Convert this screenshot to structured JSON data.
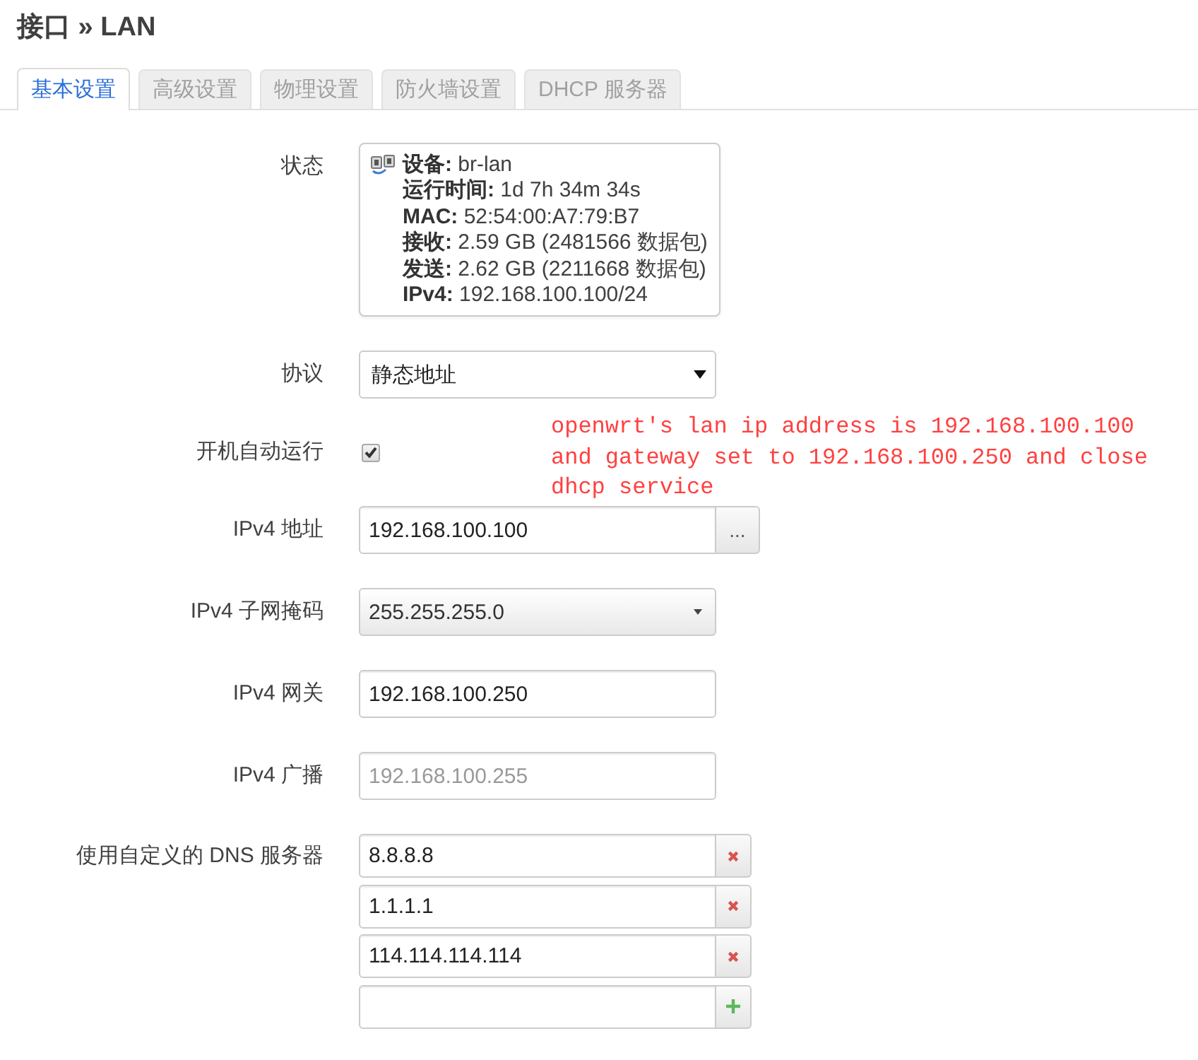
{
  "title": "接口 » LAN",
  "tabs": [
    {
      "label": "基本设置",
      "selected": true
    },
    {
      "label": "高级设置",
      "selected": false
    },
    {
      "label": "物理设置",
      "selected": false
    },
    {
      "label": "防火墙设置",
      "selected": false
    },
    {
      "label": "DHCP 服务器",
      "selected": false
    }
  ],
  "fields": [
    {
      "kind": "status",
      "label": "状态",
      "lines": [
        "**设备:** br-lan",
        "**运行时间:** 1d 7h 34m 34s",
        "**MAC:** 52:54:00:A7:79:B7",
        "**接收:** 2.59 GB (2481566 数据包)",
        "**发送:** 2.62 GB (2211668 数据包)",
        "**IPv4:** 192.168.100.100/24"
      ]
    },
    {
      "kind": "select",
      "label": "协议",
      "value": "静态地址"
    },
    {
      "kind": "checkbox",
      "label": "开机自动运行",
      "checked": true
    },
    {
      "kind": "input",
      "label": "IPv4 地址",
      "value": "192.168.100.100",
      "button": "..."
    },
    {
      "kind": "combobox",
      "label": "IPv4 子网掩码",
      "value": "255.255.255.0"
    },
    {
      "kind": "input",
      "label": "IPv4 网关",
      "value": "192.168.100.250"
    },
    {
      "kind": "input",
      "label": "IPv4 广播",
      "placeholder": "192.168.100.255"
    },
    {
      "kind": "list",
      "label": "使用自定义的 DNS 服务器",
      "entries": [
        {
          "kind": "remove",
          "value": "8.8.8.8"
        },
        {
          "kind": "remove",
          "value": "1.1.1.1"
        },
        {
          "kind": "remove",
          "value": "114.114.114.114"
        },
        {
          "kind": "add"
        }
      ]
    }
  ],
  "annotation": "openwrt's lan ip address is 192.168.100.100 and gateway set to 192.168.100.250 and close dhcp service"
}
